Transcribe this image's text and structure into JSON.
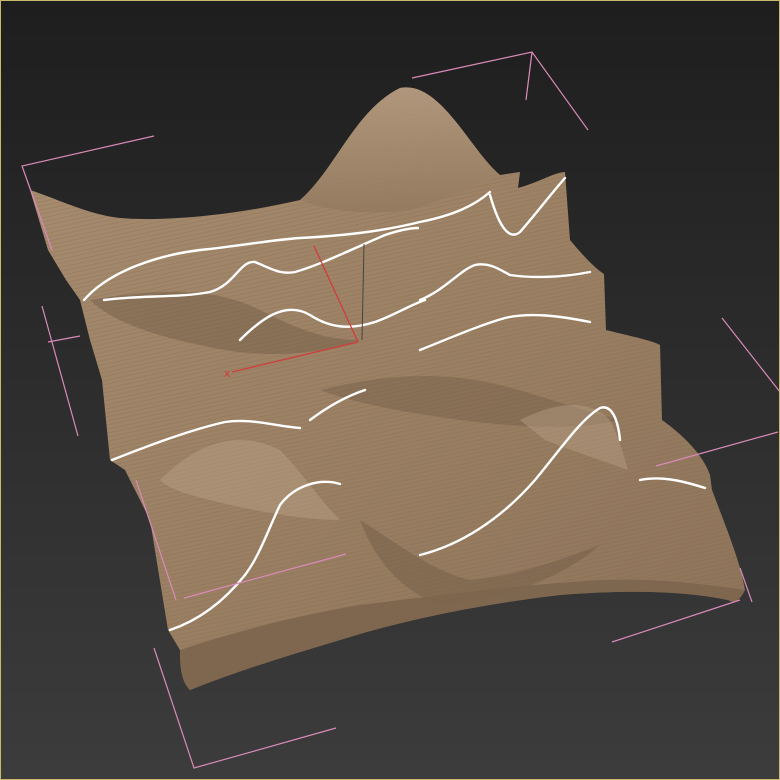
{
  "viewport": {
    "background_top": "#1e1e1e",
    "background_bottom": "#3c3c3c",
    "outline_color": "#c9b96a"
  },
  "model": {
    "material_base": "#9e8468",
    "material_light": "#b49a7c",
    "material_dark": "#6f5a45",
    "contour_line_color": "#8a7258",
    "edge_highlight_color": "#ffffff"
  },
  "selection_bracket_color": "#d98ab8",
  "gizmo": {
    "axis_color": "#d23b3b",
    "x_label": "x"
  }
}
